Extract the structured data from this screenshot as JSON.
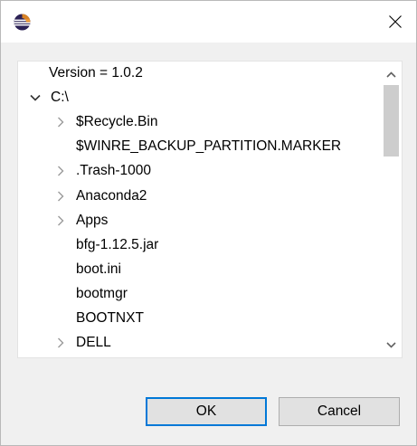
{
  "window": {
    "icon": "eclipse-app-icon",
    "close_icon": "close-icon"
  },
  "tree": {
    "items": [
      {
        "label": "Version = 1.0.2",
        "twisty": "none"
      },
      {
        "label": "C:\\",
        "twisty": "expanded"
      },
      {
        "label": "$Recycle.Bin",
        "twisty": "collapsed"
      },
      {
        "label": "$WINRE_BACKUP_PARTITION.MARKER",
        "twisty": "none"
      },
      {
        "label": ".Trash-1000",
        "twisty": "collapsed"
      },
      {
        "label": "Anaconda2",
        "twisty": "collapsed"
      },
      {
        "label": "Apps",
        "twisty": "collapsed"
      },
      {
        "label": "bfg-1.12.5.jar",
        "twisty": "none"
      },
      {
        "label": "boot.ini",
        "twisty": "none"
      },
      {
        "label": "bootmgr",
        "twisty": "none"
      },
      {
        "label": "BOOTNXT",
        "twisty": "none"
      },
      {
        "label": "DELL",
        "twisty": "collapsed"
      }
    ],
    "scrollbar": {
      "up_icon": "chevron-up-icon",
      "down_icon": "chevron-down-icon"
    }
  },
  "buttons": {
    "ok_label": "OK",
    "cancel_label": "Cancel"
  }
}
